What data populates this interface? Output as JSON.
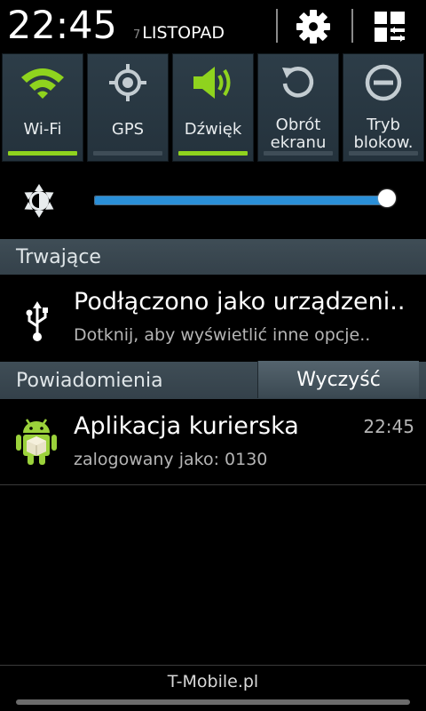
{
  "header": {
    "time": "22:45",
    "day": "7",
    "month": "LISTOPAD",
    "settings_icon": "gear-icon",
    "grid_icon": "quick-panel-edit-icon"
  },
  "toggles": [
    {
      "label": "Wi-Fi",
      "icon": "wifi-icon",
      "active": true
    },
    {
      "label": "GPS",
      "icon": "gps-icon",
      "active": false
    },
    {
      "label": "Dźwięk",
      "icon": "speaker-icon",
      "active": true
    },
    {
      "label_line1": "Obrót",
      "label_line2": "ekranu",
      "icon": "rotate-icon",
      "active": false
    },
    {
      "label_line1": "Tryb",
      "label_line2": "blokow.",
      "icon": "block-icon",
      "active": false
    }
  ],
  "brightness": {
    "icon": "brightness-icon",
    "level": 1.0
  },
  "ongoing": {
    "header": "Trwające",
    "item": {
      "icon": "usb-icon",
      "title": "Podłączono jako urządzeni..",
      "subtitle": "Dotknij, aby wyświetlić inne opcje.."
    }
  },
  "notifications": {
    "header": "Powiadomienia",
    "clear_label": "Wyczyść",
    "items": [
      {
        "icon": "android-app-icon",
        "title": "Aplikacja kurierska",
        "subtitle": "zalogowany jako: 0130",
        "time": "22:45"
      }
    ]
  },
  "footer": {
    "carrier": "T-Mobile.pl"
  },
  "colors": {
    "accent_green": "#8fd31e",
    "slider_blue": "#2a8fd8"
  }
}
